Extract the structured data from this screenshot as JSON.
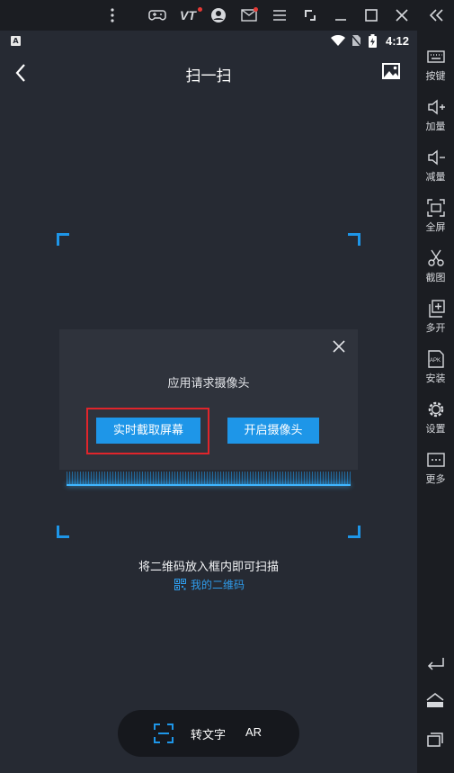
{
  "emulator": {
    "toolbar_icons": [
      "more-vert-icon",
      "gamepad-icon",
      "vt-icon",
      "avatar-icon",
      "mail-icon",
      "menu-icon",
      "resize-icon",
      "minimize-icon",
      "maximize-icon",
      "close-icon",
      "collapse-icon"
    ],
    "vt_label": "VT",
    "sidebar": [
      {
        "label": "按键",
        "icon": "keyboard-icon"
      },
      {
        "label": "加量",
        "icon": "volume-up-icon"
      },
      {
        "label": "减量",
        "icon": "volume-down-icon"
      },
      {
        "label": "全屏",
        "icon": "fullscreen-icon"
      },
      {
        "label": "截图",
        "icon": "scissors-icon"
      },
      {
        "label": "多开",
        "icon": "multi-instance-icon"
      },
      {
        "label": "安装",
        "icon": "apk-icon"
      },
      {
        "label": "设置",
        "icon": "gear-icon"
      },
      {
        "label": "更多",
        "icon": "more-icon"
      }
    ],
    "apk_badge": "APK",
    "nav": [
      "back-nav-icon",
      "home-nav-icon",
      "recents-nav-icon"
    ]
  },
  "status_bar": {
    "app_badge": "A",
    "time": "4:12"
  },
  "header": {
    "title": "扫一扫"
  },
  "dialog": {
    "message": "应用请求摄像头",
    "capture_button": "实时截取屏幕",
    "camera_button": "开启摄像头"
  },
  "scan": {
    "hint": "将二维码放入框内即可扫描",
    "my_qr": "我的二维码"
  },
  "bottom_bar": {
    "to_text": "转文字",
    "ar": "AR"
  },
  "colors": {
    "accent": "#1e96e8",
    "highlight": "#e0252b",
    "background": "#262a33"
  }
}
